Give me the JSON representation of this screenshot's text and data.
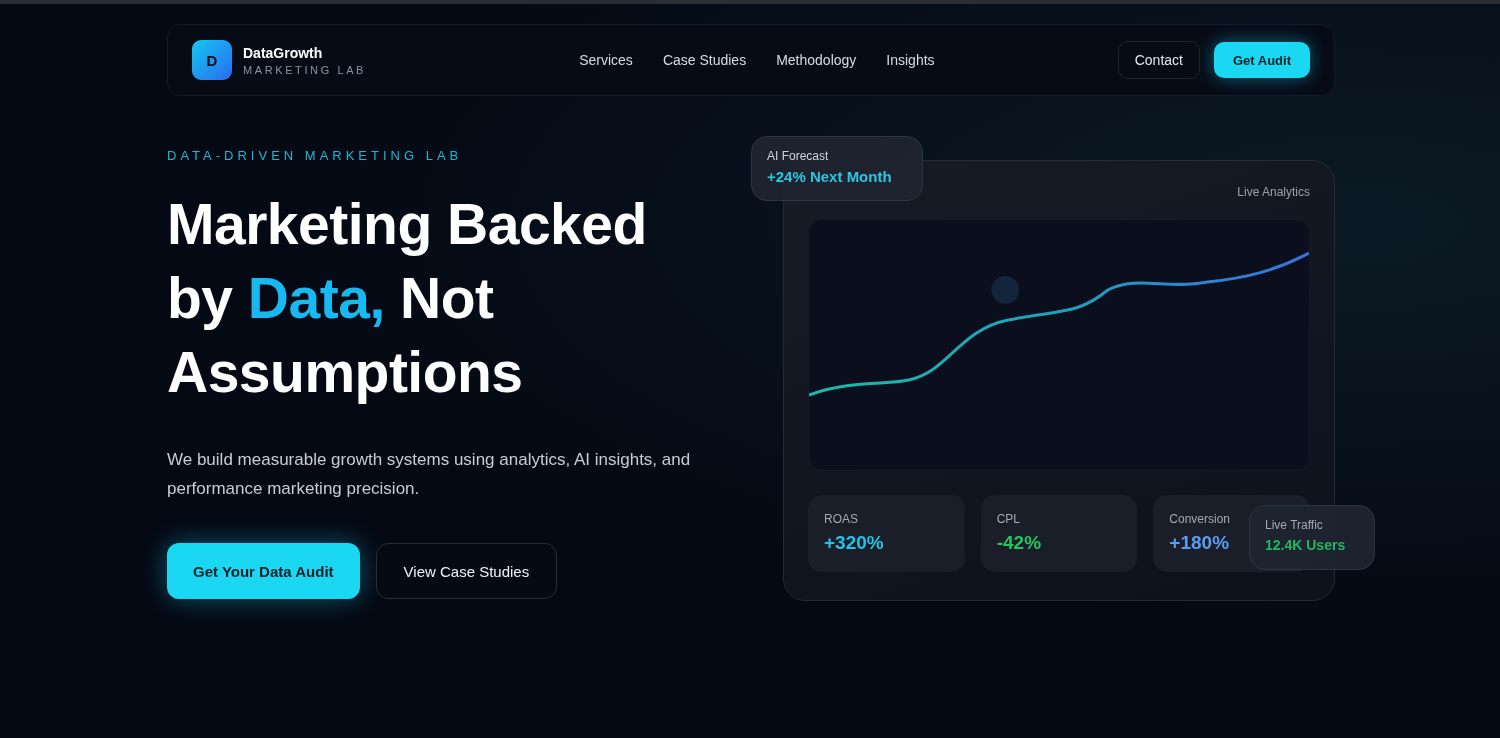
{
  "nav": {
    "logo_letter": "D",
    "brand": "DataGrowth",
    "tagline": "MARKETING LAB",
    "links": [
      "Services",
      "Case Studies",
      "Methodology",
      "Insights"
    ],
    "contact": "Contact",
    "cta": "Get Audit"
  },
  "hero": {
    "eyebrow": "DATA-DRIVEN MARKETING LAB",
    "headline": "Marketing Backed by **Data,** Not Assumptions",
    "body": "We build measurable growth systems using analytics, AI insights, and performance marketing precision.",
    "primary": "Get Your Data Audit",
    "secondary": "View Case Studies"
  },
  "dashboard": {
    "label": "Live Analytics",
    "forecast": {
      "label": "AI Forecast",
      "value": "+24% Next Month"
    },
    "metrics": [
      {
        "label": "ROAS",
        "value": "+320%",
        "color": "#22c3e6"
      },
      {
        "label": "CPL",
        "value": "-42%",
        "color": "#22c55e"
      },
      {
        "label": "Conversion",
        "value": "+180%",
        "color": "#5b9cf0"
      }
    ],
    "traffic": {
      "label": "Live Traffic",
      "value": "12.4K Users"
    }
  }
}
